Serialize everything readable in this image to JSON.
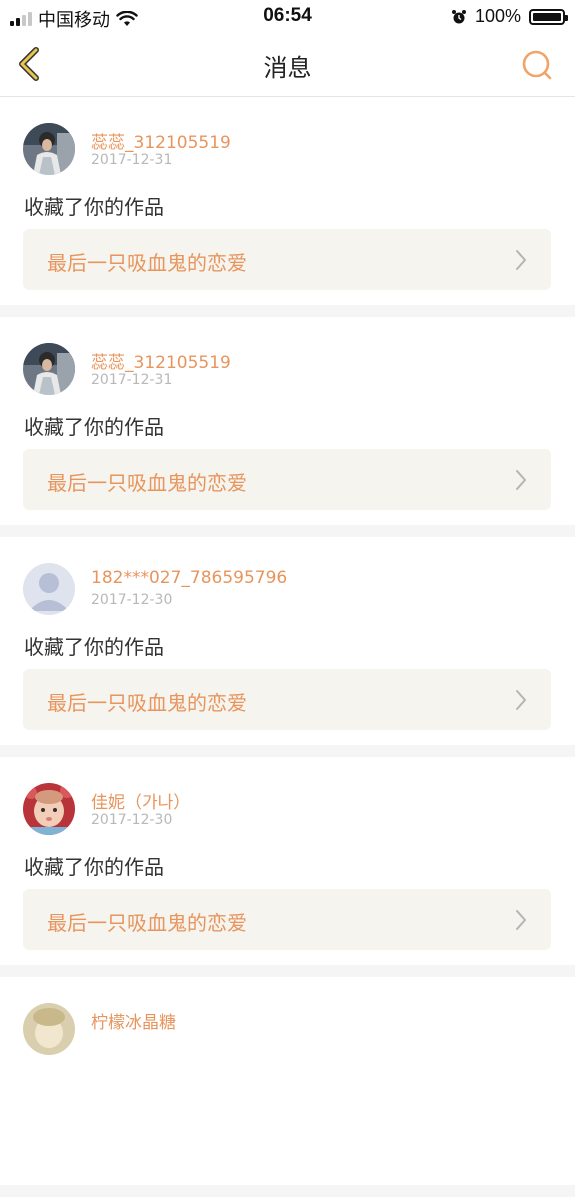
{
  "status_bar": {
    "carrier": "中国移动",
    "time": "06:54",
    "battery": "100%"
  },
  "nav": {
    "title": "消息",
    "back_icon": "chevron-left-icon",
    "search_icon": "search-icon"
  },
  "messages": [
    {
      "username": "蕊蕊_312105519",
      "date": "2017-12-31",
      "action": "收藏了你的作品",
      "work_title": "最后一只吸血鬼的恋爱",
      "avatar": "photo-person"
    },
    {
      "username": "蕊蕊_312105519",
      "date": "2017-12-31",
      "action": "收藏了你的作品",
      "work_title": "最后一只吸血鬼的恋爱",
      "avatar": "photo-person"
    },
    {
      "username": "182***027_786595796",
      "date": "2017-12-30",
      "action": "收藏了你的作品",
      "work_title": "最后一只吸血鬼的恋爱",
      "avatar": "default-avatar"
    },
    {
      "username": "佳妮（가나）",
      "date": "2017-12-30",
      "action": "收藏了你的作品",
      "work_title": "最后一只吸血鬼的恋爱",
      "avatar": "photo-baby"
    },
    {
      "username": "柠檬冰晶糖",
      "date": "",
      "action": "",
      "work_title": "",
      "avatar": "photo-doll"
    }
  ],
  "colors": {
    "accent": "#e8955d",
    "work_bg": "#f5f4ee",
    "separator": "#f6f5f5"
  }
}
